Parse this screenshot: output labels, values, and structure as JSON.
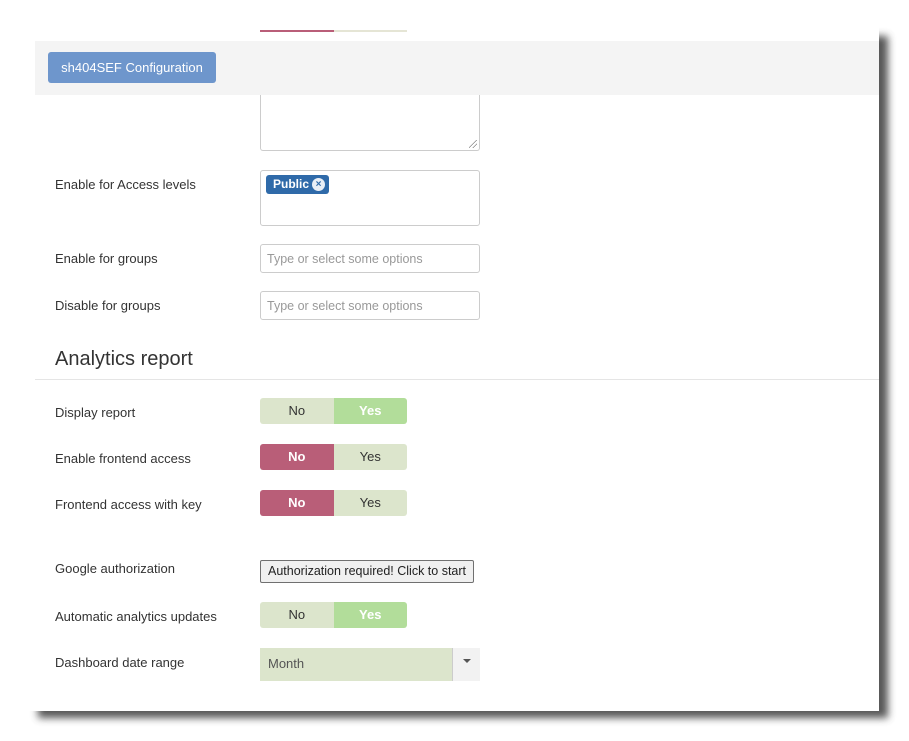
{
  "toolbar": {
    "config_button": "sh404SEF Configuration"
  },
  "access": {
    "enable_access_levels_label": "Enable for Access levels",
    "access_levels_selected": [
      "Public"
    ],
    "enable_groups_label": "Enable for groups",
    "enable_groups_placeholder": "Type or select some options",
    "disable_groups_label": "Disable for groups",
    "disable_groups_placeholder": "Type or select some options"
  },
  "analytics": {
    "section_title": "Analytics report",
    "display_report": {
      "label": "Display report",
      "no": "No",
      "yes": "Yes",
      "value": "Yes"
    },
    "enable_frontend_access": {
      "label": "Enable frontend access",
      "no": "No",
      "yes": "Yes",
      "value": "No"
    },
    "frontend_access_with_key": {
      "label": "Frontend access with key",
      "no": "No",
      "yes": "Yes",
      "value": "No"
    },
    "google_authorization": {
      "label": "Google authorization",
      "button": "Authorization required! Click to start"
    },
    "automatic_updates": {
      "label": "Automatic analytics updates",
      "no": "No",
      "yes": "Yes",
      "value": "Yes"
    },
    "dashboard_date_range": {
      "label": "Dashboard date range",
      "value": "Month"
    }
  },
  "colors": {
    "primary_button": "#6e96cc",
    "chip": "#2f6aa9",
    "toggle_yes_active": "#b2dd9a",
    "toggle_no_active": "#b95e78",
    "toggle_inactive": "#dce5cc"
  }
}
